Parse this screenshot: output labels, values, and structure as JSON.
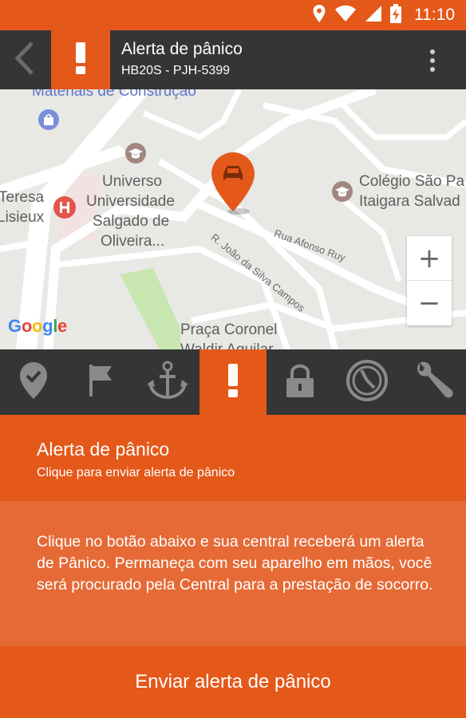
{
  "status_bar": {
    "time": "11:10",
    "icons": [
      "location-icon",
      "wifi-icon",
      "signal-icon",
      "battery-charging-icon"
    ]
  },
  "toolbar": {
    "title": "Alerta de pânico",
    "subtitle": "HB20S - PJH-5399",
    "back_icon": "chevron-left-icon",
    "badge_icon": "exclamation-icon",
    "menu_icon": "more-vert-icon"
  },
  "map": {
    "labels": {
      "materiais": "Materiais de Construção",
      "universo_1": "Universo",
      "universo_2": "Universidade",
      "universo_3": "Salgado de",
      "universo_4": "Oliveira...",
      "teresa_1": "Teresa",
      "teresa_2": "Lisieux",
      "colegio_1": "Colégio São Pa",
      "colegio_2": "Itaigara Salvad",
      "rua_afonso": "Rua Afonso Ruy",
      "rua_joao": "R. João da Silva Campos",
      "praca_1": "Praça Coronel",
      "praca_2": "Waldir Aguilar"
    },
    "zoom_in": "+",
    "zoom_out": "−",
    "google": "Google",
    "marker_icon": "car-marker-icon"
  },
  "tabs": [
    {
      "icon": "location-check-icon",
      "active": false
    },
    {
      "icon": "flag-icon",
      "active": false
    },
    {
      "icon": "anchor-icon",
      "active": false
    },
    {
      "icon": "exclamation-icon",
      "active": true
    },
    {
      "icon": "lock-icon",
      "active": false
    },
    {
      "icon": "speedometer-icon",
      "active": false
    },
    {
      "icon": "wrench-icon",
      "active": false
    }
  ],
  "panel": {
    "title": "Alerta de pânico",
    "subtitle": "Clique para enviar alerta de pânico",
    "description": "Clique no botão abaixo e sua central receberá um alerta de Pânico. Permaneça com seu aparelho em mãos, você será procurado pela Central para a prestação de socorro.",
    "button_label": "Enviar alerta de pânico"
  },
  "colors": {
    "accent": "#e4581a",
    "dark": "#353535",
    "panel_body": "#e56a36",
    "tab_icon": "#8a8a8a"
  }
}
